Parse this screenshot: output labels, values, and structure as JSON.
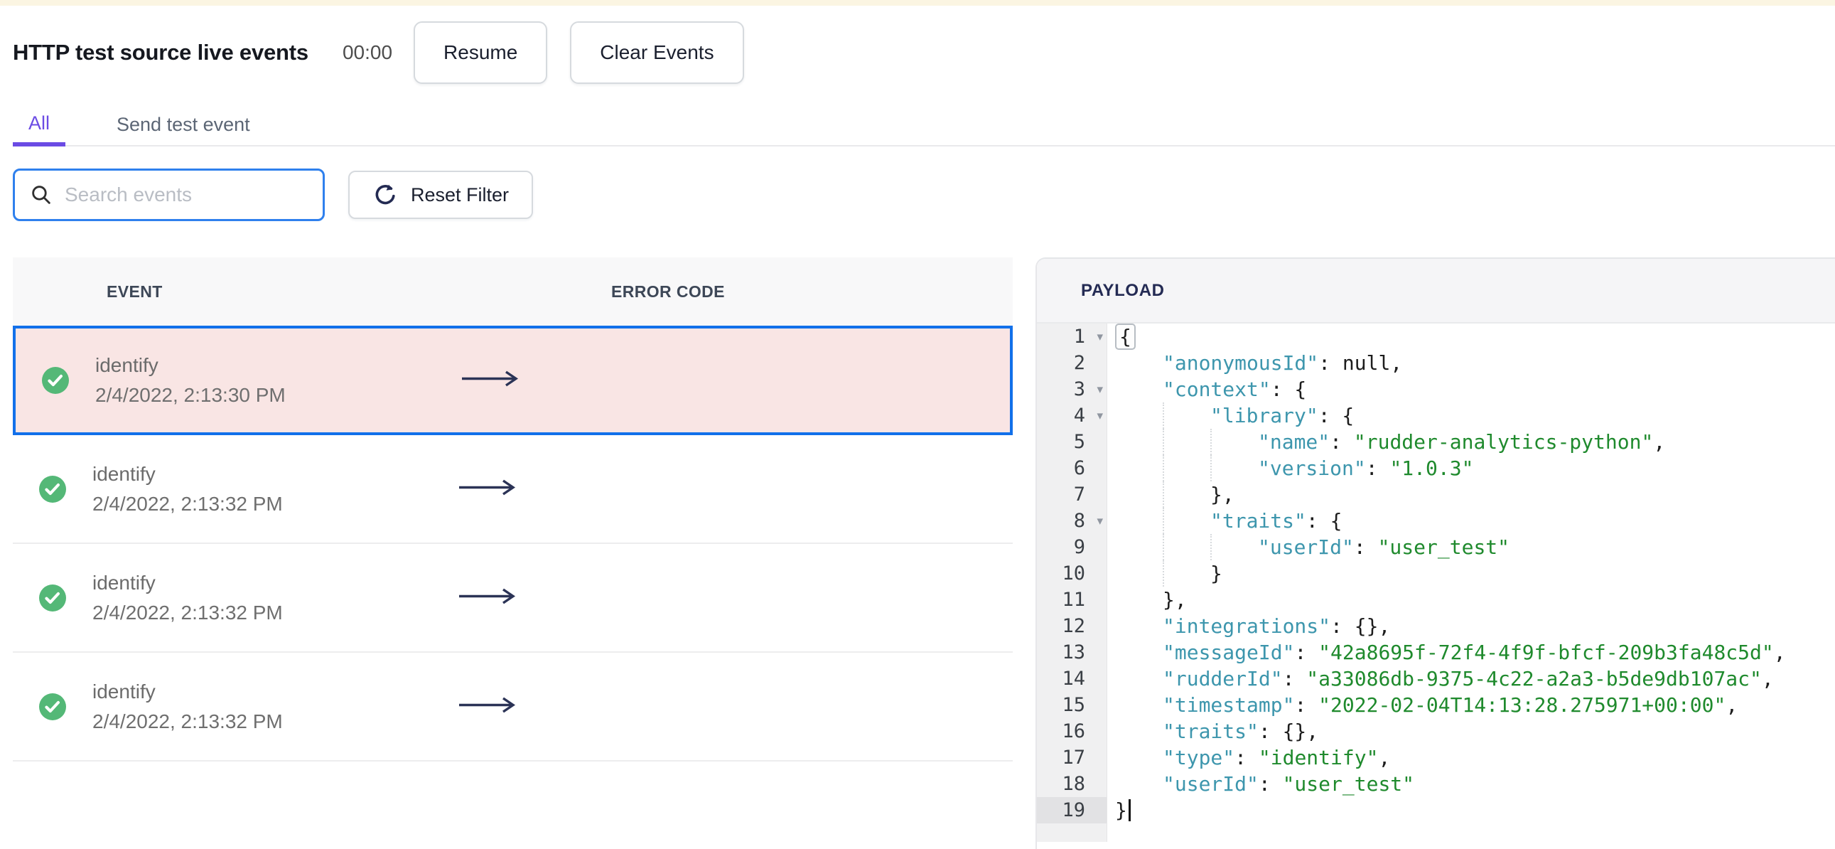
{
  "page": {
    "title": "HTTP test source live events",
    "timer": "00:00"
  },
  "toolbar": {
    "resume_label": "Resume",
    "clear_label": "Clear Events"
  },
  "tabs": [
    {
      "label": "All",
      "active": true
    },
    {
      "label": "Send test event",
      "active": false
    }
  ],
  "filter": {
    "search_placeholder": "Search events",
    "search_value": "",
    "reset_label": "Reset Filter"
  },
  "events": {
    "columns": [
      "EVENT",
      "ERROR CODE"
    ],
    "rows": [
      {
        "name": "identify",
        "time": "2/4/2022, 2:13:30 PM",
        "status": "success",
        "error_code": "",
        "selected": true
      },
      {
        "name": "identify",
        "time": "2/4/2022, 2:13:32 PM",
        "status": "success",
        "error_code": "",
        "selected": false
      },
      {
        "name": "identify",
        "time": "2/4/2022, 2:13:32 PM",
        "status": "success",
        "error_code": "",
        "selected": false
      },
      {
        "name": "identify",
        "time": "2/4/2022, 2:13:32 PM",
        "status": "success",
        "error_code": "",
        "selected": false
      }
    ]
  },
  "payload": {
    "title": "PAYLOAD",
    "lines": [
      {
        "n": 1,
        "indent": 0,
        "fold": true,
        "tokens": [
          {
            "t": "bracket",
            "v": "{"
          }
        ]
      },
      {
        "n": 2,
        "indent": 1,
        "tokens": [
          {
            "t": "key",
            "v": "anonymousId"
          },
          {
            "t": "punc",
            "v": ": "
          },
          {
            "t": "punc",
            "v": "null,"
          }
        ]
      },
      {
        "n": 3,
        "indent": 1,
        "fold": true,
        "tokens": [
          {
            "t": "key",
            "v": "context"
          },
          {
            "t": "punc",
            "v": ": {"
          }
        ]
      },
      {
        "n": 4,
        "indent": 2,
        "fold": true,
        "tokens": [
          {
            "t": "key",
            "v": "library"
          },
          {
            "t": "punc",
            "v": ": {"
          }
        ]
      },
      {
        "n": 5,
        "indent": 3,
        "tokens": [
          {
            "t": "key",
            "v": "name"
          },
          {
            "t": "punc",
            "v": ": "
          },
          {
            "t": "str",
            "v": "rudder-analytics-python"
          },
          {
            "t": "punc",
            "v": ","
          }
        ]
      },
      {
        "n": 6,
        "indent": 3,
        "tokens": [
          {
            "t": "key",
            "v": "version"
          },
          {
            "t": "punc",
            "v": ": "
          },
          {
            "t": "str",
            "v": "1.0.3"
          }
        ]
      },
      {
        "n": 7,
        "indent": 2,
        "tokens": [
          {
            "t": "punc",
            "v": "},"
          }
        ]
      },
      {
        "n": 8,
        "indent": 2,
        "fold": true,
        "tokens": [
          {
            "t": "key",
            "v": "traits"
          },
          {
            "t": "punc",
            "v": ": {"
          }
        ]
      },
      {
        "n": 9,
        "indent": 3,
        "tokens": [
          {
            "t": "key",
            "v": "userId"
          },
          {
            "t": "punc",
            "v": ": "
          },
          {
            "t": "str",
            "v": "user_test"
          }
        ]
      },
      {
        "n": 10,
        "indent": 2,
        "tokens": [
          {
            "t": "punc",
            "v": "}"
          }
        ]
      },
      {
        "n": 11,
        "indent": 1,
        "tokens": [
          {
            "t": "punc",
            "v": "},"
          }
        ]
      },
      {
        "n": 12,
        "indent": 1,
        "tokens": [
          {
            "t": "key",
            "v": "integrations"
          },
          {
            "t": "punc",
            "v": ": {},"
          }
        ]
      },
      {
        "n": 13,
        "indent": 1,
        "tokens": [
          {
            "t": "key",
            "v": "messageId"
          },
          {
            "t": "punc",
            "v": ": "
          },
          {
            "t": "str",
            "v": "42a8695f-72f4-4f9f-bfcf-209b3fa48c5d"
          },
          {
            "t": "punc",
            "v": ","
          }
        ]
      },
      {
        "n": 14,
        "indent": 1,
        "tokens": [
          {
            "t": "key",
            "v": "rudderId"
          },
          {
            "t": "punc",
            "v": ": "
          },
          {
            "t": "str",
            "v": "a33086db-9375-4c22-a2a3-b5de9db107ac"
          },
          {
            "t": "punc",
            "v": ","
          }
        ]
      },
      {
        "n": 15,
        "indent": 1,
        "tokens": [
          {
            "t": "key",
            "v": "timestamp"
          },
          {
            "t": "punc",
            "v": ": "
          },
          {
            "t": "str",
            "v": "2022-02-04T14:13:28.275971+00:00"
          },
          {
            "t": "punc",
            "v": ","
          }
        ]
      },
      {
        "n": 16,
        "indent": 1,
        "tokens": [
          {
            "t": "key",
            "v": "traits"
          },
          {
            "t": "punc",
            "v": ": {},"
          }
        ]
      },
      {
        "n": 17,
        "indent": 1,
        "tokens": [
          {
            "t": "key",
            "v": "type"
          },
          {
            "t": "punc",
            "v": ": "
          },
          {
            "t": "str",
            "v": "identify"
          },
          {
            "t": "punc",
            "v": ","
          }
        ]
      },
      {
        "n": 18,
        "indent": 1,
        "tokens": [
          {
            "t": "key",
            "v": "userId"
          },
          {
            "t": "punc",
            "v": ": "
          },
          {
            "t": "str",
            "v": "user_test"
          }
        ]
      },
      {
        "n": 19,
        "indent": 0,
        "active": true,
        "cursor": true,
        "tokens": [
          {
            "t": "punc",
            "v": "}"
          }
        ]
      }
    ]
  },
  "icons": {
    "search": "search-icon",
    "reset": "refresh-icon",
    "status": "success-check-icon",
    "row_arrow": "arrow-right-icon",
    "fold": "chevron-down-icon"
  },
  "colors": {
    "accent": "#6b4be4",
    "selected_border": "#1270ea",
    "selected_bg": "#f9e5e4",
    "success": "#54b877",
    "key": "#3d96ad",
    "string": "#1f8a2d",
    "search_border": "#2f80ed",
    "arrow": "#2b3356",
    "strip": "#fbf5e2"
  }
}
